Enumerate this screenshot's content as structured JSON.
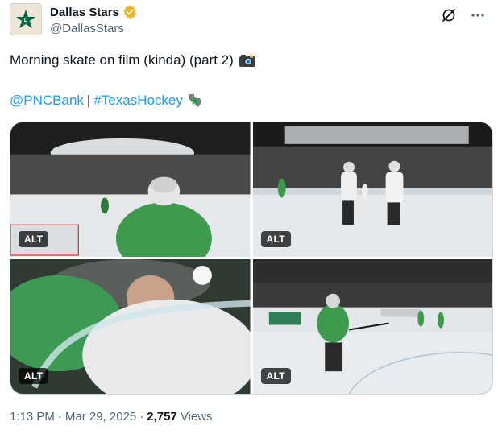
{
  "author": {
    "display_name": "Dallas Stars",
    "handle": "@DallasStars",
    "verified_color": "#e8b829"
  },
  "icons": {
    "grok": "grok-icon",
    "more": "more-icon",
    "camera_emoji": "camera-emoji-icon",
    "texas_star_emoji": "texas-star-emoji-icon"
  },
  "tweet": {
    "text": "Morning skate on film (kinda) (part 2)",
    "links": {
      "mention": "@PNCBank",
      "separator": "|",
      "hashtag": "#TexasHockey"
    }
  },
  "media": {
    "alt_labels": [
      "ALT",
      "ALT",
      "ALT",
      "ALT"
    ]
  },
  "meta": {
    "time": "1:13 PM",
    "dot1": "·",
    "date": "Mar 29, 2025",
    "dot2": "·",
    "views_count": "2,757",
    "views_label": "Views"
  },
  "colors": {
    "link": "#1d9bf0",
    "stars_green": "#2e9a4e",
    "muted": "#536471"
  }
}
